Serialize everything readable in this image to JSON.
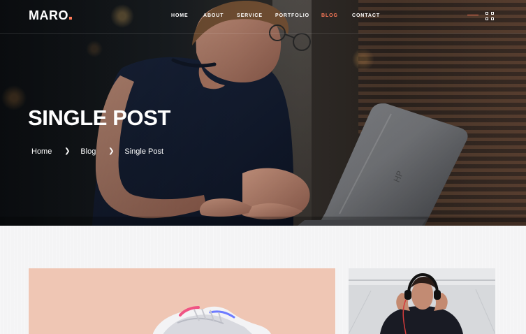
{
  "header": {
    "logo": "MARO",
    "nav": [
      {
        "label": "HOME",
        "active": false
      },
      {
        "label": "ABOUT",
        "active": false
      },
      {
        "label": "SERVICE",
        "active": false
      },
      {
        "label": "PORTFOLIO",
        "active": false
      },
      {
        "label": "BLOG",
        "active": true
      },
      {
        "label": "CONTACT",
        "active": false
      }
    ],
    "menu_icon": "grid-menu-icon"
  },
  "hero": {
    "title": "SINGLE POST",
    "breadcrumb": [
      "Home",
      "Blog",
      "Single Post"
    ]
  },
  "colors": {
    "accent": "#ff7a59",
    "white": "#ffffff",
    "page_bg": "#f6f6f7"
  },
  "content": {
    "post_image": "sneaker-photo",
    "sidebar_image": "headphones-man-photo"
  }
}
